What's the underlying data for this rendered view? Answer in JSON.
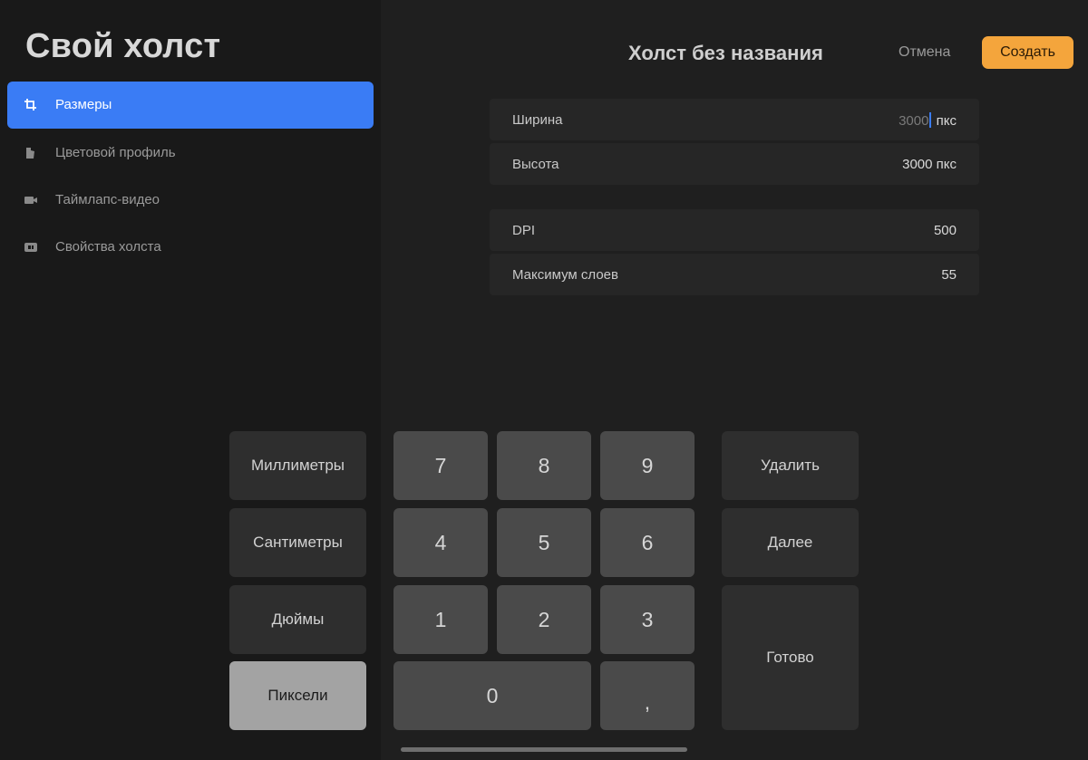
{
  "sidebar": {
    "title": "Свой холст",
    "items": [
      {
        "label": "Размеры",
        "icon": "crop-icon",
        "active": true
      },
      {
        "label": "Цветовой профиль",
        "icon": "color-profile-icon",
        "active": false
      },
      {
        "label": "Таймлапс-видео",
        "icon": "video-camera-icon",
        "active": false
      },
      {
        "label": "Свойства холста",
        "icon": "canvas-properties-icon",
        "active": false
      }
    ]
  },
  "header": {
    "title": "Холст без названия",
    "cancel_label": "Отмена",
    "create_label": "Создать"
  },
  "fields": {
    "width": {
      "label": "Ширина",
      "value": "3000",
      "unit": "пкс"
    },
    "height": {
      "label": "Высота",
      "value": "3000 пкс"
    },
    "dpi": {
      "label": "DPI",
      "value": "500"
    },
    "max_layers": {
      "label": "Максимум слоев",
      "value": "55"
    }
  },
  "keypad": {
    "units": [
      "Миллиметры",
      "Сантиметры",
      "Дюймы",
      "Пиксели"
    ],
    "selected_unit": "Пиксели",
    "digits": [
      "7",
      "8",
      "9",
      "4",
      "5",
      "6",
      "1",
      "2",
      "3",
      "0",
      ","
    ],
    "delete_label": "Удалить",
    "next_label": "Далее",
    "done_label": "Готово"
  },
  "colors": {
    "accent_blue": "#3a7cf5",
    "create_orange": "#f4a53c",
    "background": "#1f1f1f",
    "sidebar_bg": "#191919"
  }
}
